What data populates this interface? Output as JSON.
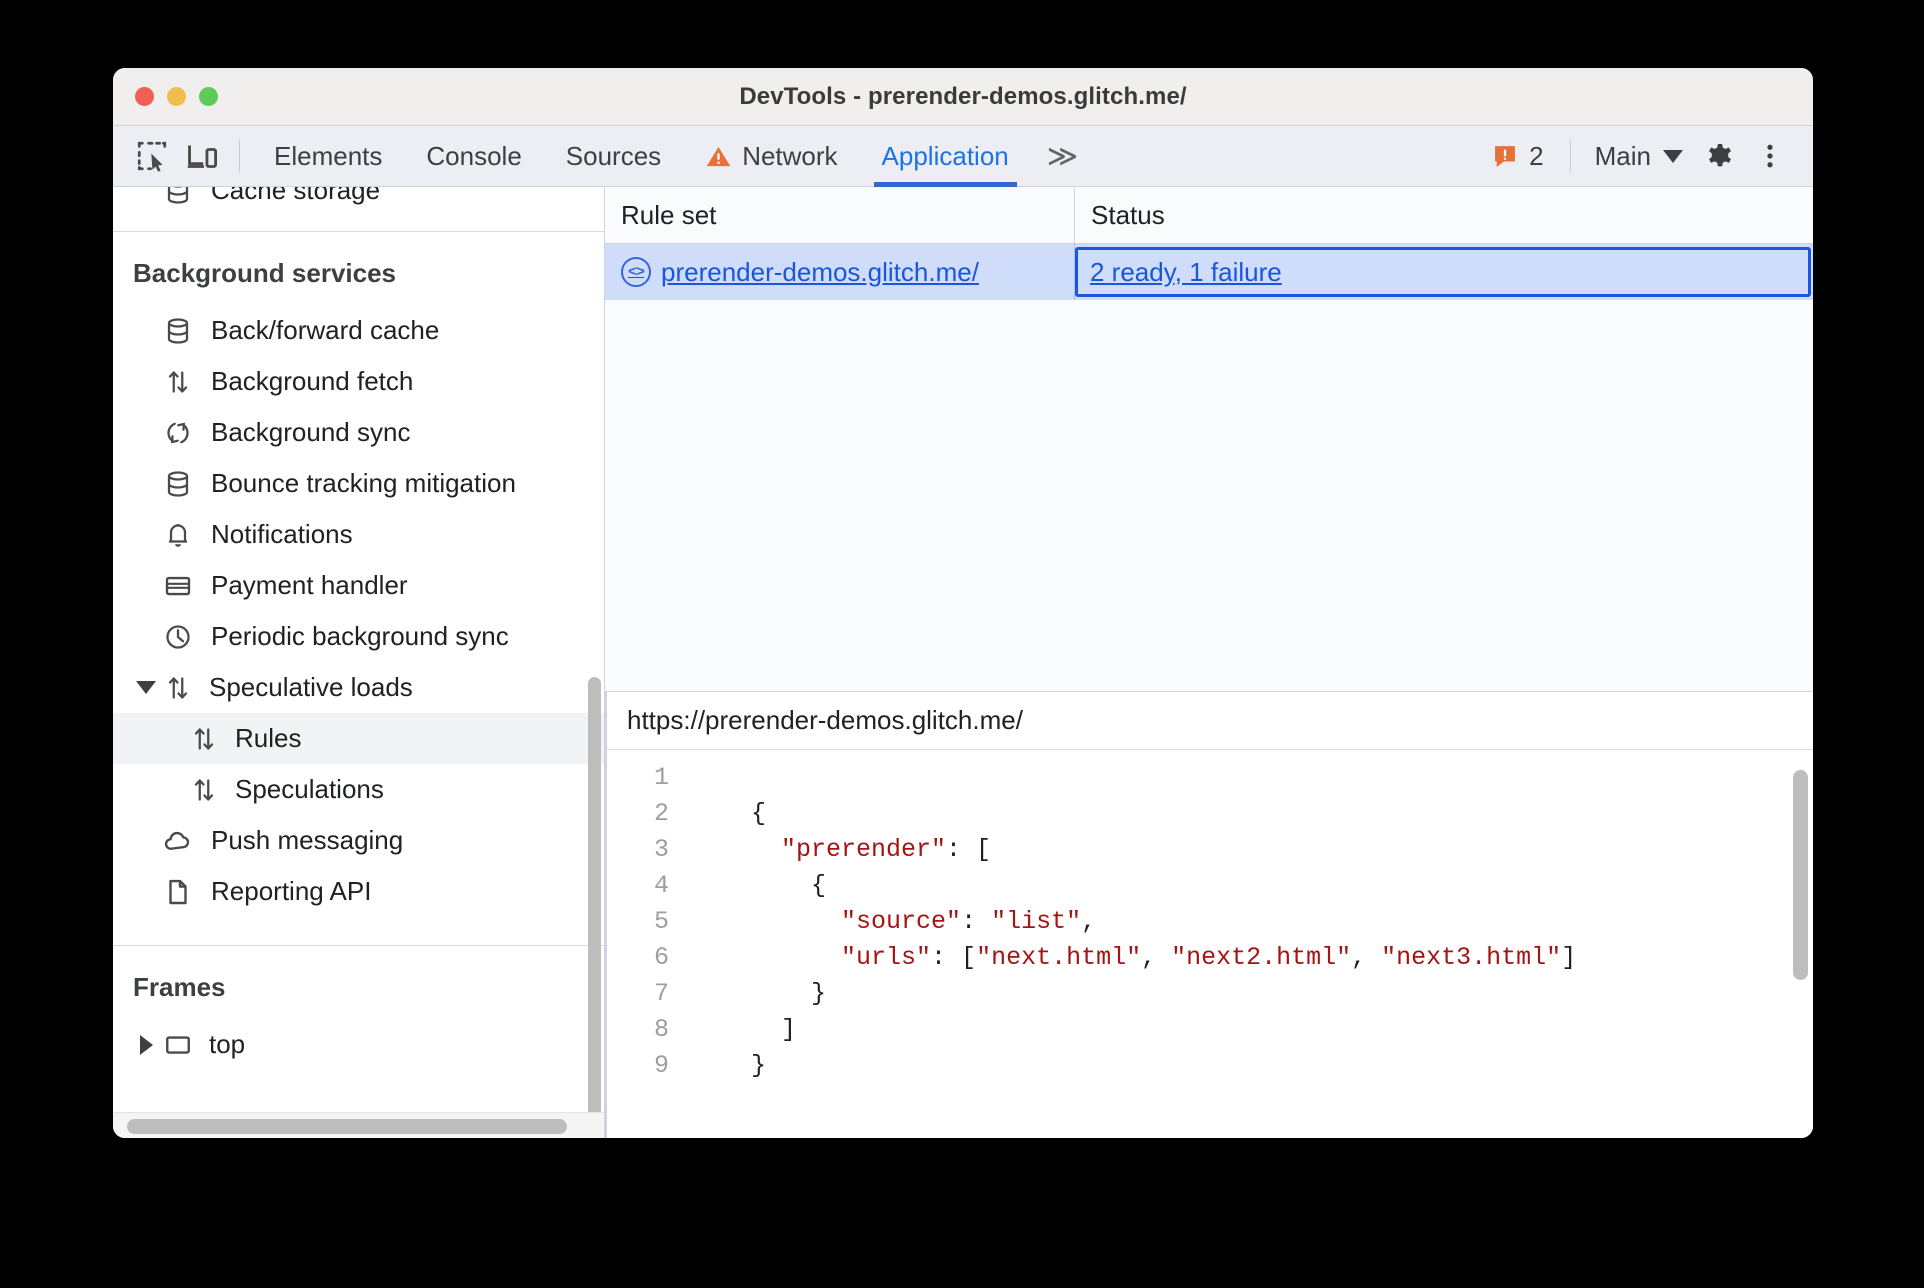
{
  "window": {
    "title": "DevTools - prerender-demos.glitch.me/",
    "traffic_lights": [
      "close",
      "minimize",
      "maximize"
    ]
  },
  "toolbar": {
    "inspect_icon": "inspect-element-icon",
    "device_icon": "device-toolbar-icon",
    "tabs": [
      {
        "label": "Elements",
        "active": false,
        "warning": false
      },
      {
        "label": "Console",
        "active": false,
        "warning": false
      },
      {
        "label": "Sources",
        "active": false,
        "warning": false
      },
      {
        "label": "Network",
        "active": false,
        "warning": true
      },
      {
        "label": "Application",
        "active": true,
        "warning": false
      }
    ],
    "more_tabs_label": "≫",
    "issues_count": "2",
    "issues_icon": "issue-warning-icon",
    "context_label": "Main",
    "settings_icon": "gear-icon",
    "menu_icon": "more-vertical-icon",
    "accent_color": "#1a73e8",
    "warning_color": "#e8713a"
  },
  "sidebar": {
    "clipped_item": {
      "label": "Cache storage",
      "icon": "database-icon"
    },
    "sections": [
      {
        "header": "Background services",
        "items": [
          {
            "label": "Back/forward cache",
            "icon": "database-icon",
            "level": 1,
            "selected": false,
            "twisty": "none"
          },
          {
            "label": "Background fetch",
            "icon": "updown-arrows-icon",
            "level": 1,
            "selected": false,
            "twisty": "none"
          },
          {
            "label": "Background sync",
            "icon": "sync-icon",
            "level": 1,
            "selected": false,
            "twisty": "none"
          },
          {
            "label": "Bounce tracking mitigation",
            "icon": "database-icon",
            "level": 1,
            "selected": false,
            "twisty": "none"
          },
          {
            "label": "Notifications",
            "icon": "bell-icon",
            "level": 1,
            "selected": false,
            "twisty": "none"
          },
          {
            "label": "Payment handler",
            "icon": "credit-card-icon",
            "level": 1,
            "selected": false,
            "twisty": "none"
          },
          {
            "label": "Periodic background sync",
            "icon": "clock-icon",
            "level": 1,
            "selected": false,
            "twisty": "none"
          },
          {
            "label": "Speculative loads",
            "icon": "updown-arrows-icon",
            "level": 1,
            "selected": false,
            "twisty": "down"
          },
          {
            "label": "Rules",
            "icon": "updown-arrows-icon",
            "level": 2,
            "selected": true,
            "twisty": "none"
          },
          {
            "label": "Speculations",
            "icon": "updown-arrows-icon",
            "level": 2,
            "selected": false,
            "twisty": "none"
          },
          {
            "label": "Push messaging",
            "icon": "cloud-icon",
            "level": 1,
            "selected": false,
            "twisty": "none"
          },
          {
            "label": "Reporting API",
            "icon": "document-icon",
            "level": 1,
            "selected": false,
            "twisty": "none"
          }
        ]
      },
      {
        "header": "Frames",
        "items": [
          {
            "label": "top",
            "icon": "frame-icon",
            "level": 1,
            "selected": false,
            "twisty": "right"
          }
        ]
      }
    ]
  },
  "main": {
    "grid": {
      "columns": [
        "Rule set",
        "Status"
      ],
      "rows": [
        {
          "ruleset": "prerender-demos.glitch.me/",
          "ruleset_icon": "code-circle-icon",
          "status": "2 ready, 1 failure",
          "selected": true,
          "status_focused": true
        }
      ],
      "selected_row_color": "#cfddfb",
      "link_color": "#1a56db"
    },
    "code_viewer": {
      "url": "https://prerender-demos.glitch.me/",
      "lines": [
        {
          "no": "1",
          "content": ""
        },
        {
          "no": "2",
          "content": "    {"
        },
        {
          "no": "3",
          "content": "      \"prerender\": ["
        },
        {
          "no": "4",
          "content": "        {"
        },
        {
          "no": "5",
          "content": "          \"source\": \"list\","
        },
        {
          "no": "6",
          "content": "          \"urls\": [\"next.html\", \"next2.html\", \"next3.html\"]"
        },
        {
          "no": "7",
          "content": "        }"
        },
        {
          "no": "8",
          "content": "      ]"
        },
        {
          "no": "9",
          "content": "    }"
        }
      ],
      "string_color": "#a31515"
    }
  }
}
